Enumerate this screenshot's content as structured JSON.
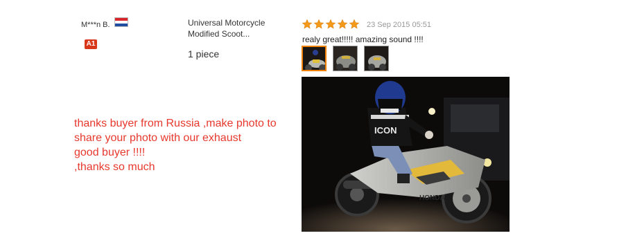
{
  "review": {
    "buyer_name": "M***n B.",
    "country_flag": "netherlands-flag",
    "buyer_level": "A1",
    "product_title": "Universal Motorcycle Modified Scoot...",
    "quantity": "1 piece",
    "rating": 5,
    "max_rating": 5,
    "date": "23 Sep 2015 05:51",
    "text": "realy great!!!!! amazing sound !!!!",
    "thumbnails": [
      {
        "name": "review-photo-thumbnail-1",
        "selected": true
      },
      {
        "name": "review-photo-thumbnail-2",
        "selected": false
      },
      {
        "name": "review-photo-thumbnail-3",
        "selected": false
      }
    ]
  },
  "seller_note": {
    "lines": [
      "thanks buyer from Russia ,make photo to",
      "share your photo with our exhaust",
      "good buyer !!!!",
      ",thanks so much"
    ]
  },
  "photo": {
    "jacket_text": "ICON",
    "bike_text": "HONDA"
  },
  "colors": {
    "star": "#f49a1b",
    "selected_thumb_border": "#f08200",
    "seller_note": "#e8382d",
    "date": "#999999",
    "badge": "#d9371a"
  }
}
